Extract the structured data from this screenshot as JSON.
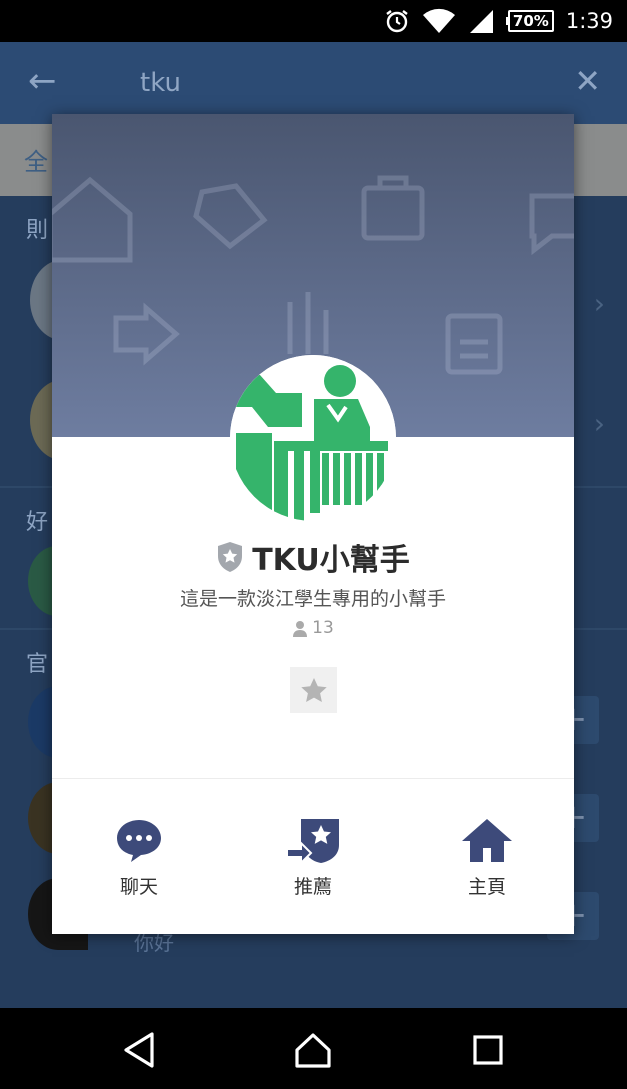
{
  "status_bar": {
    "battery": "70%",
    "time": "1:39"
  },
  "background": {
    "search_query": "tku",
    "tab_label": "全",
    "section1": "則",
    "section2": "好",
    "section3": "官",
    "sub_text": "你好"
  },
  "dialog": {
    "name": "TKU小幫手",
    "description": "這是一款淡江學生專用的小幫手",
    "followers": "13",
    "actions": [
      {
        "label": "聊天",
        "icon": "chat-bubble-icon"
      },
      {
        "label": "推薦",
        "icon": "recommend-icon"
      },
      {
        "label": "主頁",
        "icon": "home-icon"
      }
    ]
  },
  "colors": {
    "accent": "#3d4a7a",
    "avatar_green": "#35b46b",
    "cover": "#5a6788"
  }
}
